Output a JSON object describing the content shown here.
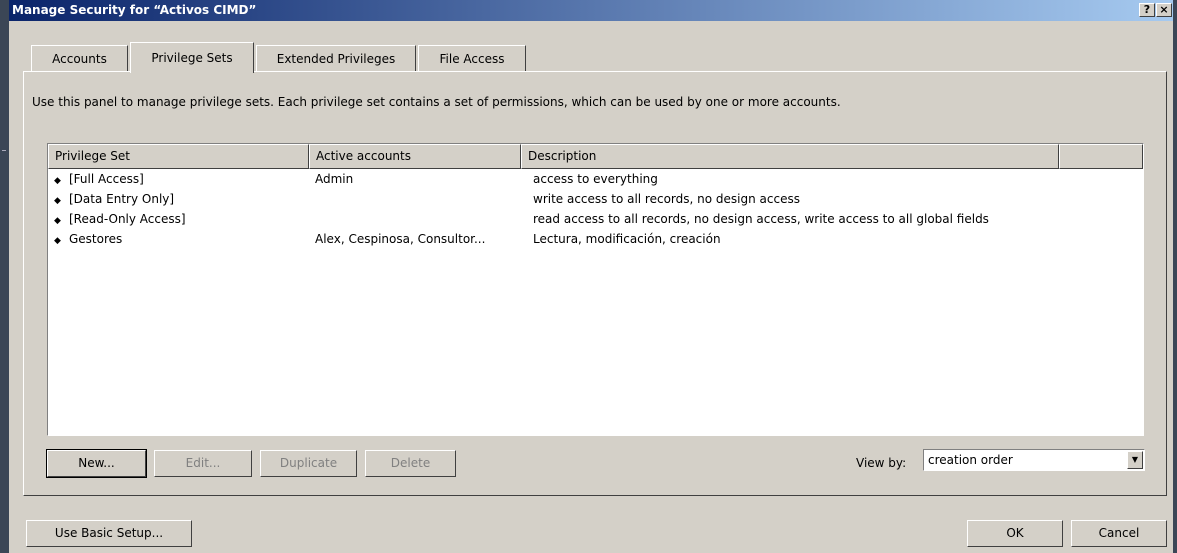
{
  "window": {
    "title": "Manage Security for “Activos CIMD”",
    "help_label": "?",
    "close_label": "×"
  },
  "tabs": [
    "Accounts",
    "Privilege Sets",
    "Extended Privileges",
    "File Access"
  ],
  "panel": {
    "description": "Use this panel to manage privilege sets. Each privilege set contains a set of permissions, which can be used by one or more accounts."
  },
  "table": {
    "columns": [
      "Privilege Set",
      "Active accounts",
      "Description"
    ],
    "rows": [
      {
        "name": "[Full Access]",
        "accounts": "Admin",
        "description": "access to everything"
      },
      {
        "name": "[Data Entry Only]",
        "accounts": "",
        "description": "write access to all records, no design access"
      },
      {
        "name": "[Read-Only Access]",
        "accounts": "",
        "description": "read access to all records, no design access, write access to all global fields"
      },
      {
        "name": "Gestores",
        "accounts": "Alex, Cespinosa, Consultor...",
        "description": "Lectura, modificación, creación"
      }
    ],
    "row_bullet": "◆"
  },
  "buttons": {
    "new": "New...",
    "edit": "Edit...",
    "duplicate": "Duplicate",
    "delete": "Delete",
    "use_basic_setup": "Use Basic Setup...",
    "ok": "OK",
    "cancel": "Cancel"
  },
  "view_by": {
    "label": "View by:",
    "value": "creation order",
    "arrow": "▼"
  }
}
